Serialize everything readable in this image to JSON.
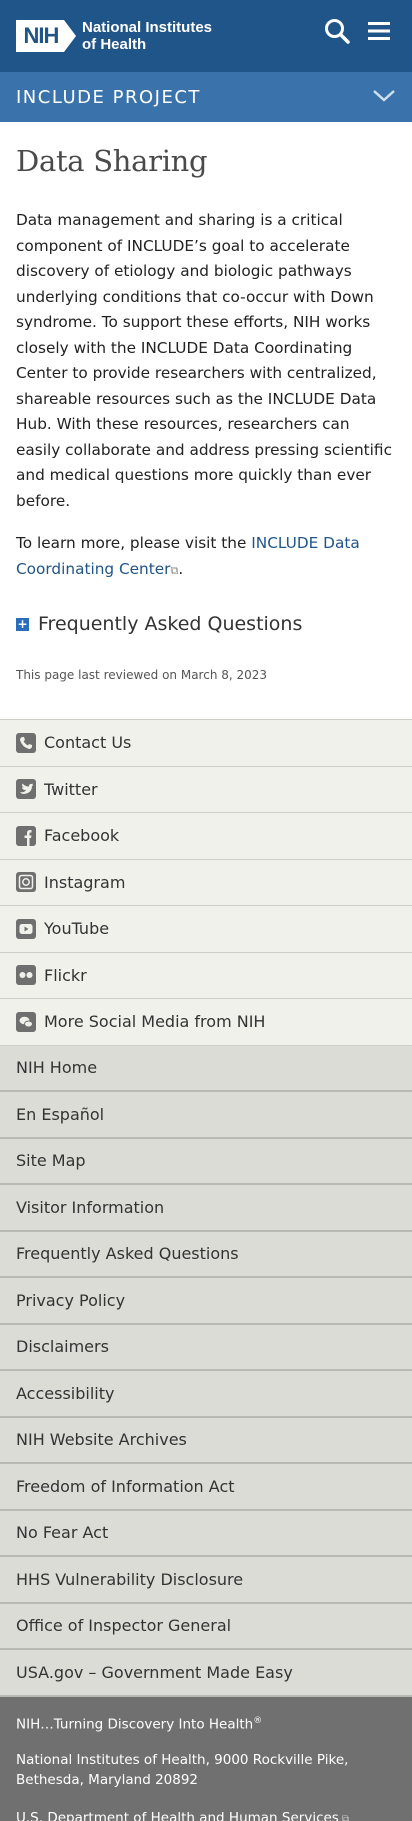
{
  "header": {
    "logo_abbr": "NIH",
    "logo_line1": "National Institutes",
    "logo_line2": "of Health",
    "section_title": "INCLUDE PROJECT"
  },
  "main": {
    "title": "Data Sharing",
    "paragraph1": "Data management and sharing is a critical component of INCLUDE’s goal to accelerate discovery of etiology and biologic pathways underlying conditions that co-occur with Down syndrome. To support these efforts, NIH works closely with the INCLUDE Data Coordinating Center to provide researchers with centralized, shareable resources such as the INCLUDE Data Hub. With these resources, researchers can easily collaborate and address pressing scientific and medical questions more quickly than ever before.",
    "paragraph2_prefix": "To learn more, please visit the ",
    "paragraph2_link": "INCLUDE Data Coordinating Center",
    "paragraph2_suffix": ".",
    "faq_label": "Frequently Asked Questions",
    "reviewed": "This page last reviewed on March 8, 2023"
  },
  "social": [
    {
      "label": "Contact Us",
      "icon": "phone-icon"
    },
    {
      "label": "Twitter",
      "icon": "twitter-icon"
    },
    {
      "label": "Facebook",
      "icon": "facebook-icon"
    },
    {
      "label": "Instagram",
      "icon": "instagram-icon"
    },
    {
      "label": "YouTube",
      "icon": "youtube-icon"
    },
    {
      "label": "Flickr",
      "icon": "flickr-icon"
    },
    {
      "label": "More Social Media from NIH",
      "icon": "chat-icon"
    }
  ],
  "links": [
    "NIH Home",
    "En Español",
    "Site Map",
    "Visitor Information",
    "Frequently Asked Questions",
    "Privacy Policy",
    "Disclaimers",
    "Accessibility",
    "NIH Website Archives",
    "Freedom of Information Act",
    "No Fear Act",
    "HHS Vulnerability Disclosure",
    "Office of Inspector General",
    "USA.gov – Government Made Easy"
  ],
  "bottom": {
    "tagline": "NIH…Turning Discovery Into Health",
    "tagline_mark": "®",
    "address_line1": "National Institutes of Health, 9000 Rockville Pike,",
    "address_line2": "Bethesda, Maryland 20892",
    "hhs": "U.S. Department of Health and Human Services"
  },
  "colors": {
    "header_bg": "#20558a",
    "subbar_bg": "#3a73ab",
    "link": "#20558a",
    "footer_bottom": "#707070"
  }
}
